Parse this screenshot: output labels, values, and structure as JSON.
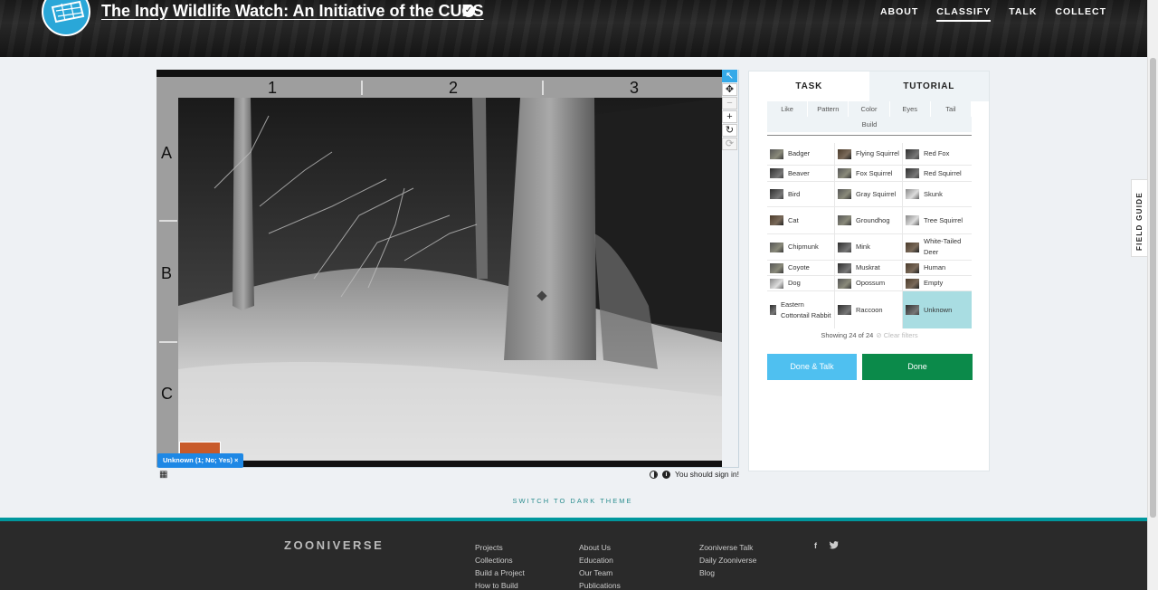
{
  "header": {
    "title": "The Indy Wildlife Watch: An Initiative of the CUES",
    "nav": [
      {
        "label": "ABOUT",
        "active": false
      },
      {
        "label": "CLASSIFY",
        "active": true
      },
      {
        "label": "TALK",
        "active": false
      },
      {
        "label": "COLLECT",
        "active": false
      }
    ]
  },
  "viewer": {
    "columns": [
      "1",
      "2",
      "3"
    ],
    "rows": [
      "A",
      "B",
      "C"
    ],
    "annotation_tag": "Unknown (1; No; Yes) ×",
    "sign_in_note": "You should sign in!"
  },
  "panel": {
    "tabs": [
      {
        "label": "TASK",
        "active": true
      },
      {
        "label": "TUTORIAL",
        "active": false
      }
    ],
    "filters_row1": [
      "Like",
      "Pattern",
      "Color",
      "Eyes",
      "Tail"
    ],
    "filters_row2": [
      "Build"
    ],
    "choices": [
      [
        "Badger",
        "Flying Squirrel",
        "Red Fox"
      ],
      [
        "Beaver",
        "Fox Squirrel",
        "Red Squirrel"
      ],
      [
        "Bird",
        "Gray Squirrel",
        "Skunk"
      ],
      [
        "Cat",
        "Groundhog",
        "Tree Squirrel"
      ],
      [
        "Chipmunk",
        "Mink",
        "White-Tailed Deer"
      ],
      [
        "Coyote",
        "Muskrat",
        "Human"
      ],
      [
        "Dog",
        "Opossum",
        "Empty"
      ],
      [
        "Eastern Cottontail Rabbit",
        "Raccoon",
        "Unknown"
      ]
    ],
    "selected_choice": "Unknown",
    "showing": "Showing 24 of 24",
    "clear_filters": "⊘ Clear filters",
    "done_talk_label": "Done & Talk",
    "done_label": "Done"
  },
  "field_guide": "FIELD GUIDE",
  "dark_theme_link": "SWITCH TO DARK THEME",
  "footer": {
    "logo": "ZOONIVERSE",
    "col1": [
      "Projects",
      "Collections",
      "Build a Project",
      "How to Build"
    ],
    "col2": [
      "About Us",
      "Education",
      "Our Team",
      "Publications"
    ],
    "col3": [
      "Zooniverse Talk",
      "Daily Zooniverse",
      "Blog"
    ],
    "social": [
      "f",
      "t"
    ]
  },
  "colors": {
    "accent_blue": "#1e88e5",
    "done_green": "#0b8a4a",
    "done_talk_blue": "#4fc0f0",
    "selected_teal": "#a9dde2",
    "footer_teal": "#00979d"
  }
}
